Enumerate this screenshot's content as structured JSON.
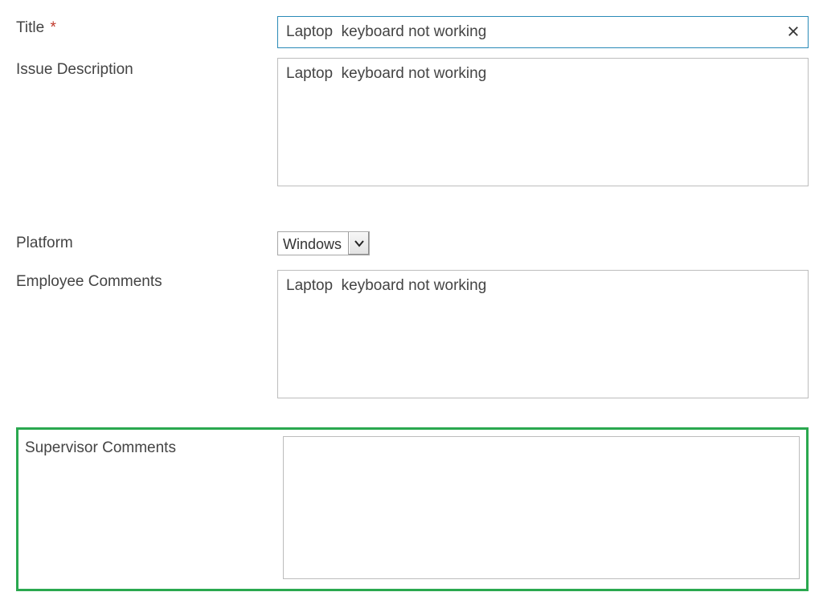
{
  "form": {
    "title": {
      "label": "Title",
      "required_marker": "*",
      "value": "Laptop  keyboard not working"
    },
    "issue_description": {
      "label": "Issue Description",
      "value": "Laptop  keyboard not working"
    },
    "platform": {
      "label": "Platform",
      "value": "Windows"
    },
    "employee_comments": {
      "label": "Employee Comments",
      "value": "Laptop  keyboard not working"
    },
    "supervisor_comments": {
      "label": "Supervisor Comments",
      "value": ""
    }
  }
}
